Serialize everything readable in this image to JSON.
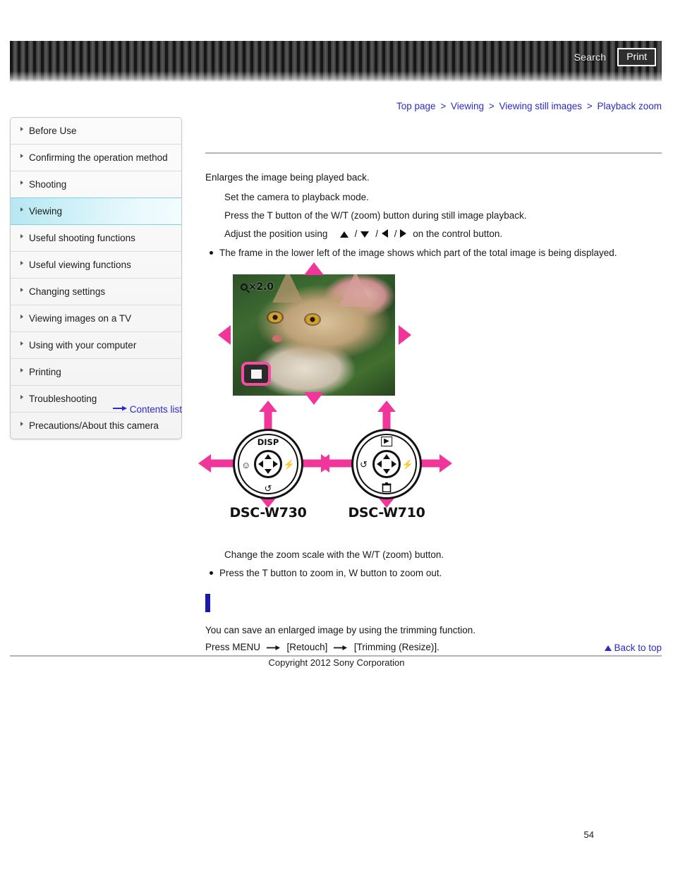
{
  "header": {
    "search_label": "Search",
    "print_label": "Print"
  },
  "breadcrumb": {
    "items": [
      "Top page",
      "Viewing",
      "Viewing still images",
      "Playback zoom"
    ],
    "separator": ">"
  },
  "sidebar": {
    "items": [
      {
        "label": "Before Use",
        "active": false
      },
      {
        "label": "Confirming the operation method",
        "active": false
      },
      {
        "label": "Shooting",
        "active": false
      },
      {
        "label": "Viewing",
        "active": true
      },
      {
        "label": "Useful shooting functions",
        "active": false
      },
      {
        "label": "Useful viewing functions",
        "active": false
      },
      {
        "label": "Changing settings",
        "active": false
      },
      {
        "label": "Viewing images on a TV",
        "active": false
      },
      {
        "label": "Using with your computer",
        "active": false
      },
      {
        "label": "Printing",
        "active": false
      },
      {
        "label": "Troubleshooting",
        "active": false
      },
      {
        "label": "Precautions/About this camera",
        "active": false
      }
    ],
    "contents_list_label": "Contents list",
    "active_accent": "#7fd3e6"
  },
  "main": {
    "title": "",
    "intro": "Enlarges the image being played back.",
    "steps": [
      "Set the camera to playback mode.",
      "Press the T button of the W/T (zoom) button during still image playback."
    ],
    "adjust_prefix": "Adjust the position using",
    "adjust_suffix": "on the control button.",
    "note_frame": "The frame in the lower left of the image shows which part of the total image is being displayed.",
    "zoom_scale_line": "Change the zoom scale with the W/T (zoom) button.",
    "note_zoom": "Press the T button to zoom in, W button to zoom out."
  },
  "illustration": {
    "zoom_badge": "×2.0",
    "wheels": [
      {
        "name": "DSC-W730",
        "top_label": "DISP",
        "left_icon": "☺",
        "right_icon": "⚡",
        "bottom_icon": "↺"
      },
      {
        "name": "DSC-W710",
        "top_label": "▶",
        "left_icon": "↺",
        "right_icon": "⚡",
        "bottom_icon": "Ὕ1"
      }
    ],
    "arrow_color": "#f0359b"
  },
  "trimming": {
    "heading": "",
    "line1": "You can save an enlarged image by using the trimming function.",
    "line2_prefix": "Press MENU",
    "line2_mid": "[Retouch]",
    "line2_end": "[Trimming (Resize)]."
  },
  "footer": {
    "back_to_top": "Back to top",
    "copyright": "Copyright 2012 Sony Corporation",
    "page_number": "54"
  }
}
